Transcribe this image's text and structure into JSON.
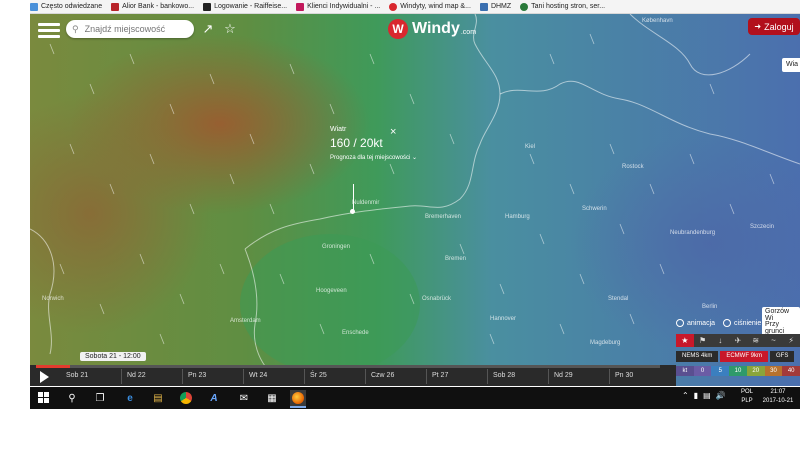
{
  "bookmarks": [
    {
      "label": "Często odwiedzane",
      "icon": "globe-icon",
      "color": "#4a90d9"
    },
    {
      "label": "Alior Bank - bankowo...",
      "icon": "alior-icon",
      "color": "#b8242a"
    },
    {
      "label": "Logowanie - Raiffeise...",
      "icon": "raiffeisen-icon",
      "color": "#222222"
    },
    {
      "label": "Klienci Indywidualni - ...",
      "icon": "mbank-icon",
      "color": "#c2185b"
    },
    {
      "label": "Windyty, wind map &...",
      "icon": "windy-icon",
      "color": "#d9272e"
    },
    {
      "label": "DHMZ",
      "icon": "dhmz-icon",
      "color": "#3a6fb0"
    },
    {
      "label": "Tani hosting stron, ser...",
      "icon": "hosting-icon",
      "color": "#2a7a3a"
    }
  ],
  "header": {
    "search_placeholder": "Znajdź miejscowość",
    "logo_badge": "W",
    "logo_name": "Windy",
    "logo_domain": ".com",
    "login_label": "Zaloguj",
    "right_popup": "Wia"
  },
  "wind_popup": {
    "label": "Wiatr",
    "value": "160 / 20kt",
    "forecast_label": "Prognoza dla tej miejscowości",
    "close": "×"
  },
  "cities": [
    "København",
    "Kiel",
    "Rostock",
    "Schwerin",
    "Hamburg",
    "Bremerhaven",
    "Nuldenmir",
    "Groningen",
    "Amsterdam",
    "Bremen",
    "Hannover",
    "Stendal",
    "Berlin",
    "Norwich",
    "Magdeburg",
    "Hoogeveen",
    "Enschede",
    "Osnabrück",
    "Szczecin",
    "Neubrandenburg"
  ],
  "map_labels": {
    "gorzow": "Gorzów Wi",
    "przy": "Przy grunci"
  },
  "layers": {
    "animation": "animacja",
    "pressure": "ciśnienie"
  },
  "controls": [
    "★",
    "⚑",
    "↓",
    "✈",
    "≋",
    "~",
    "⚡"
  ],
  "models": [
    {
      "label": "NEMS 4km",
      "selected": false
    },
    {
      "label": "ECMWF 9km",
      "selected": true
    },
    {
      "label": "GFS",
      "selected": false
    }
  ],
  "scale": {
    "unit": "kt",
    "steps": [
      {
        "label": "0",
        "color": "#6b5ca5"
      },
      {
        "label": "5",
        "color": "#3b7fbf"
      },
      {
        "label": "10",
        "color": "#2f9a6a"
      },
      {
        "label": "20",
        "color": "#8aa53a"
      },
      {
        "label": "30",
        "color": "#b8722e"
      },
      {
        "label": "40",
        "color": "#a33a3a"
      }
    ]
  },
  "timeline": {
    "current_time": "Sobota 21 - 12:00",
    "progress": 0.055,
    "days": [
      "Sob 21",
      "Nd 22",
      "Pn 23",
      "Wt 24",
      "Śr 25",
      "Czw 26",
      "Pt 27",
      "Sob 28",
      "Nd 29",
      "Pn 30"
    ]
  },
  "taskbar": {
    "apps": [
      "search-icon",
      "task-view-icon",
      "edge-icon",
      "file-explorer-icon",
      "chrome-icon",
      "app-a-icon",
      "mail-icon",
      "store-icon",
      "firefox-icon"
    ],
    "language": "POL",
    "keyboard": "PLP",
    "time": "21:07",
    "date": "2017-10-21"
  }
}
